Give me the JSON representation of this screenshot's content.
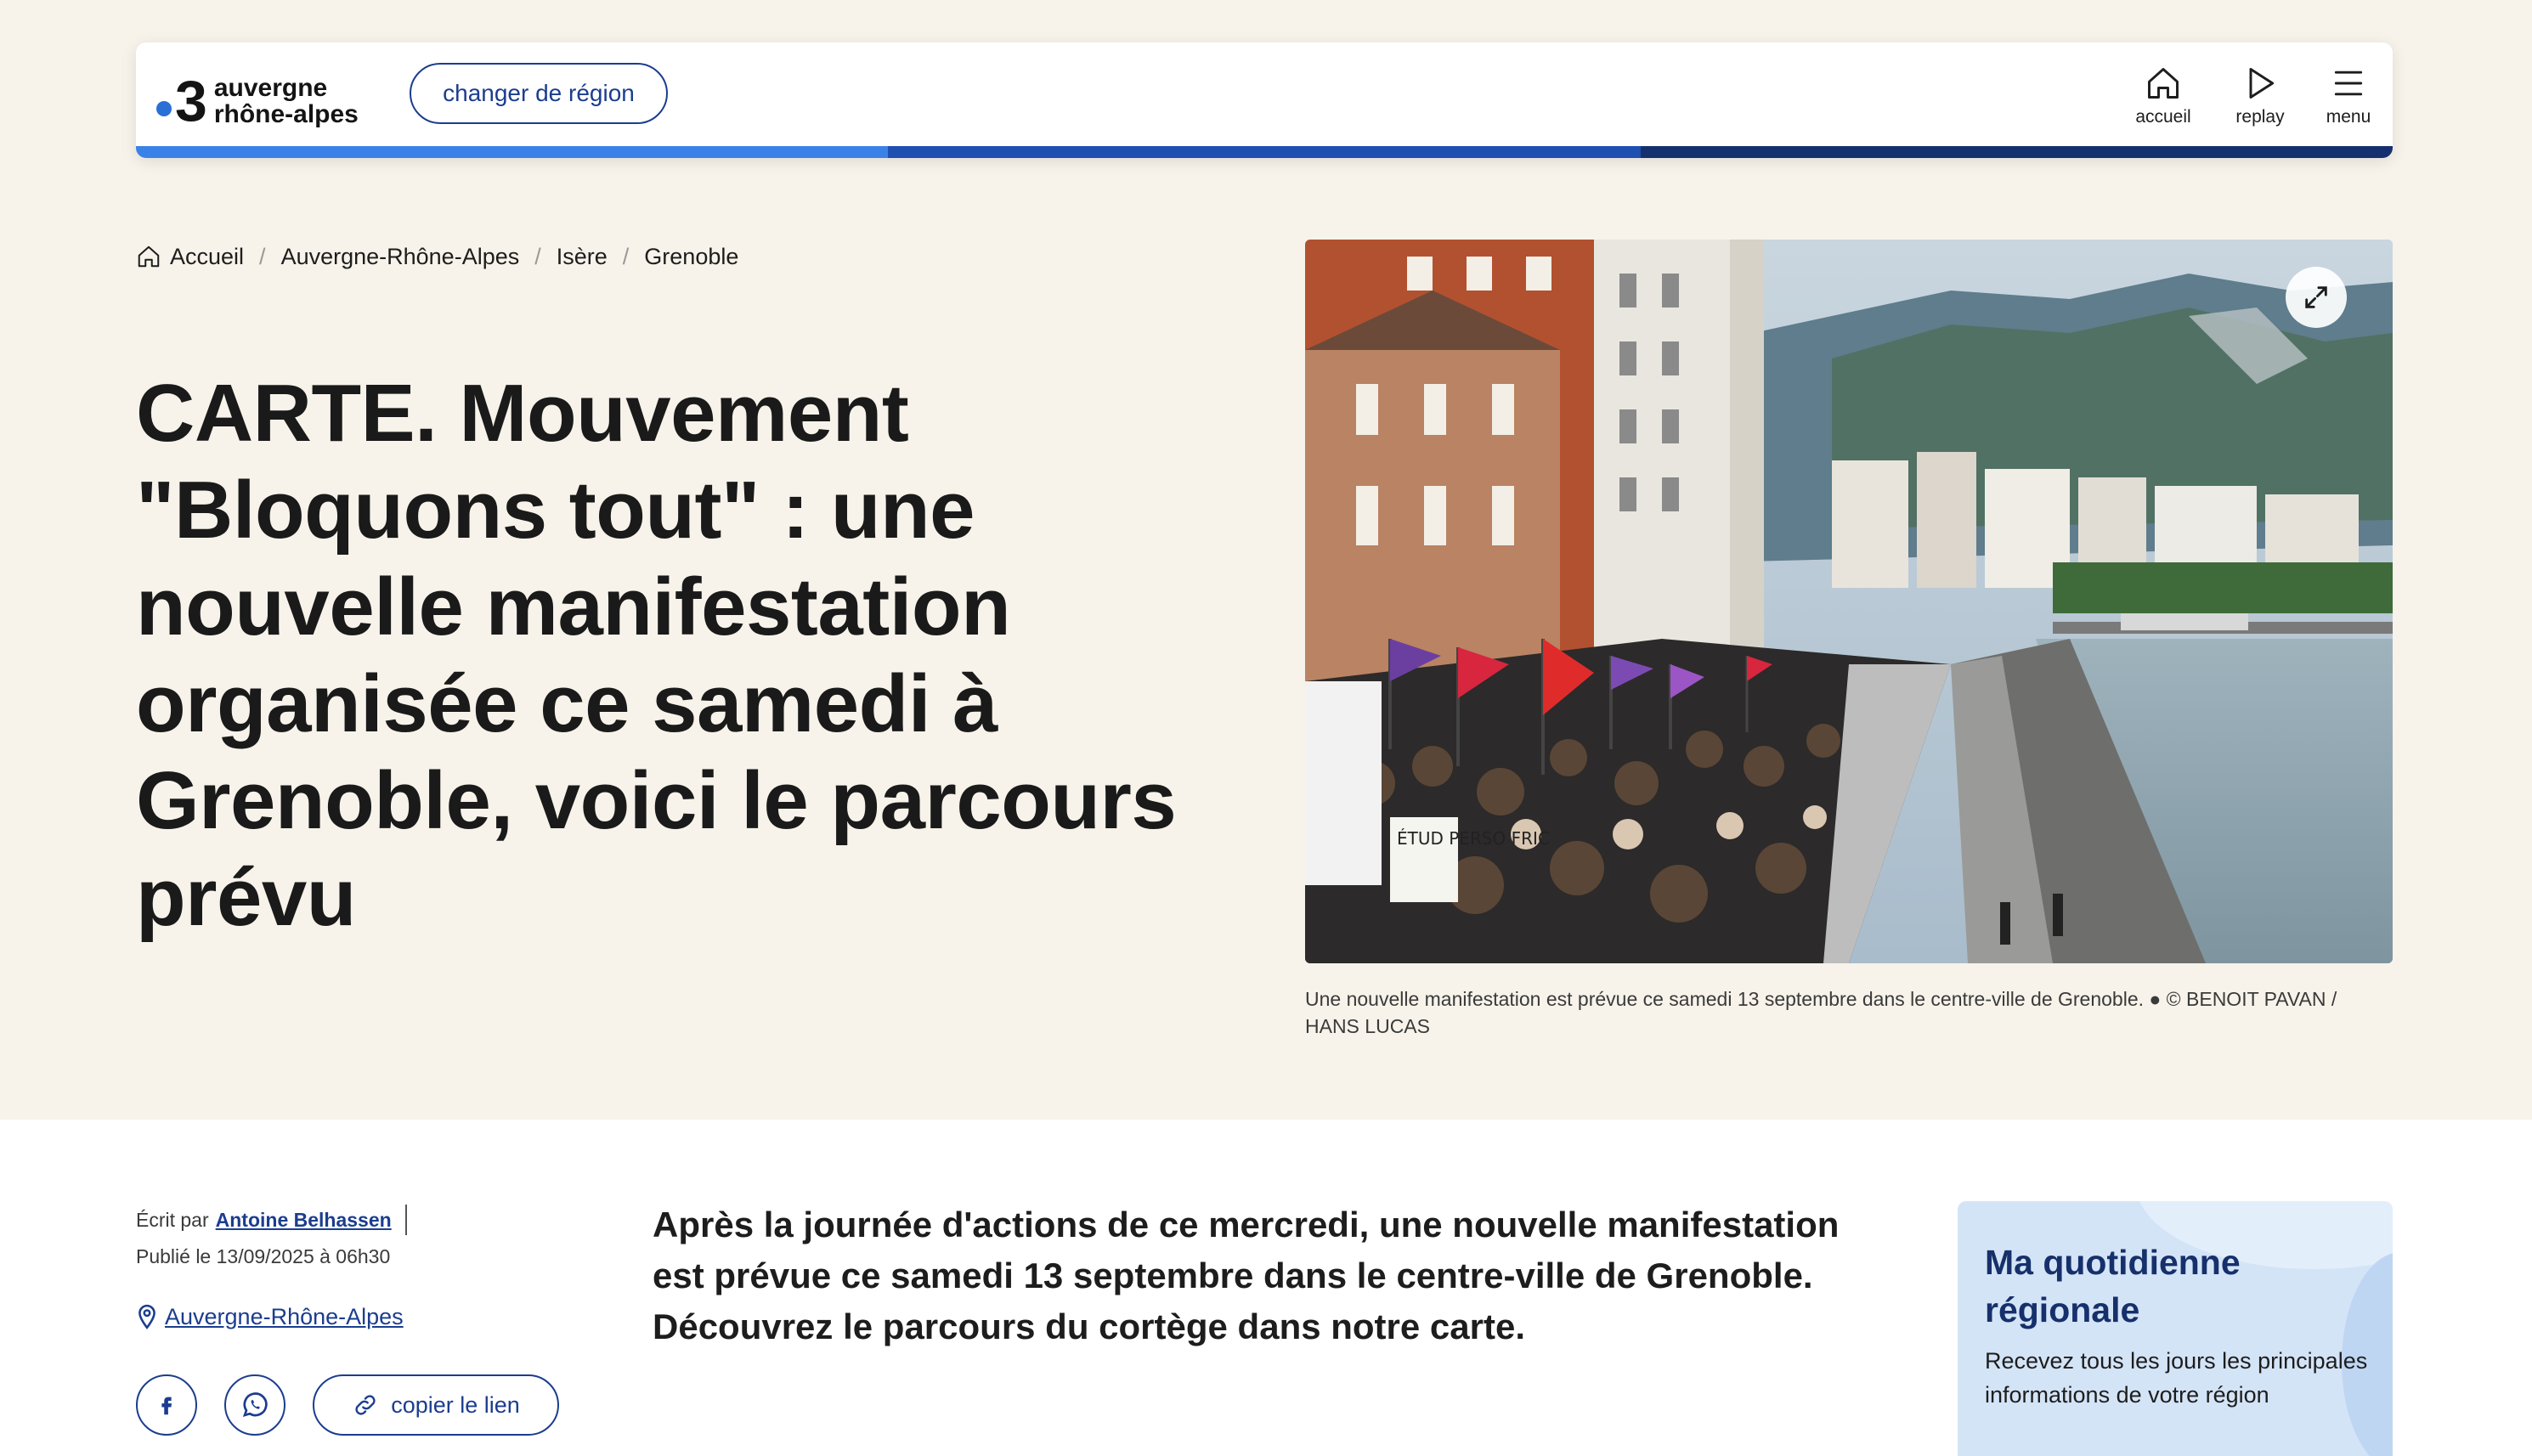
{
  "header": {
    "logo_number": "3",
    "logo_line1": "auvergne",
    "logo_line2": "rhône-alpes",
    "region_button": "changer de région",
    "nav": {
      "accueil": "accueil",
      "replay": "replay",
      "menu": "menu"
    }
  },
  "breadcrumb": [
    "Accueil",
    "Auvergne-Rhône-Alpes",
    "Isère",
    "Grenoble"
  ],
  "article": {
    "title": "CARTE. Mouvement \"Bloquons tout\" : une nouvelle manifestation organisée ce samedi à Grenoble, voici le parcours prévu",
    "photo_caption": "Une nouvelle manifestation est prévue ce samedi 13 septembre dans le centre-ville de Grenoble. ● © BENOIT PAVAN / HANS LUCAS",
    "photo_sign_text": "ÉTUD PERSO FRIC",
    "author_prefix": "Écrit par",
    "author_name": "Antoine Belhassen",
    "published": "Publié le 13/09/2025 à 06h30",
    "location": "Auvergne-Rhône-Alpes",
    "copy_link": "copier le lien",
    "lead": "Après la journée d'actions de ce mercredi, une nouvelle manifestation est prévue ce samedi 13 septembre dans le centre-ville de Grenoble. Découvrez le parcours du cortège dans notre carte."
  },
  "newsletter": {
    "title": "Ma quotidienne régionale",
    "text": "Recevez tous les jours les principales informations de votre région"
  },
  "colors": {
    "background_top": "#f7f3ea",
    "brand_blue": "#1b3d8f",
    "progress": [
      "#3b82e8",
      "#1f4fb0",
      "#15306f"
    ],
    "newsletter_bg": "#d4e4f7"
  },
  "icons": [
    "home-icon",
    "play-icon",
    "menu-icon",
    "expand-icon",
    "location-pin-icon",
    "facebook-icon",
    "whatsapp-icon",
    "link-icon"
  ]
}
